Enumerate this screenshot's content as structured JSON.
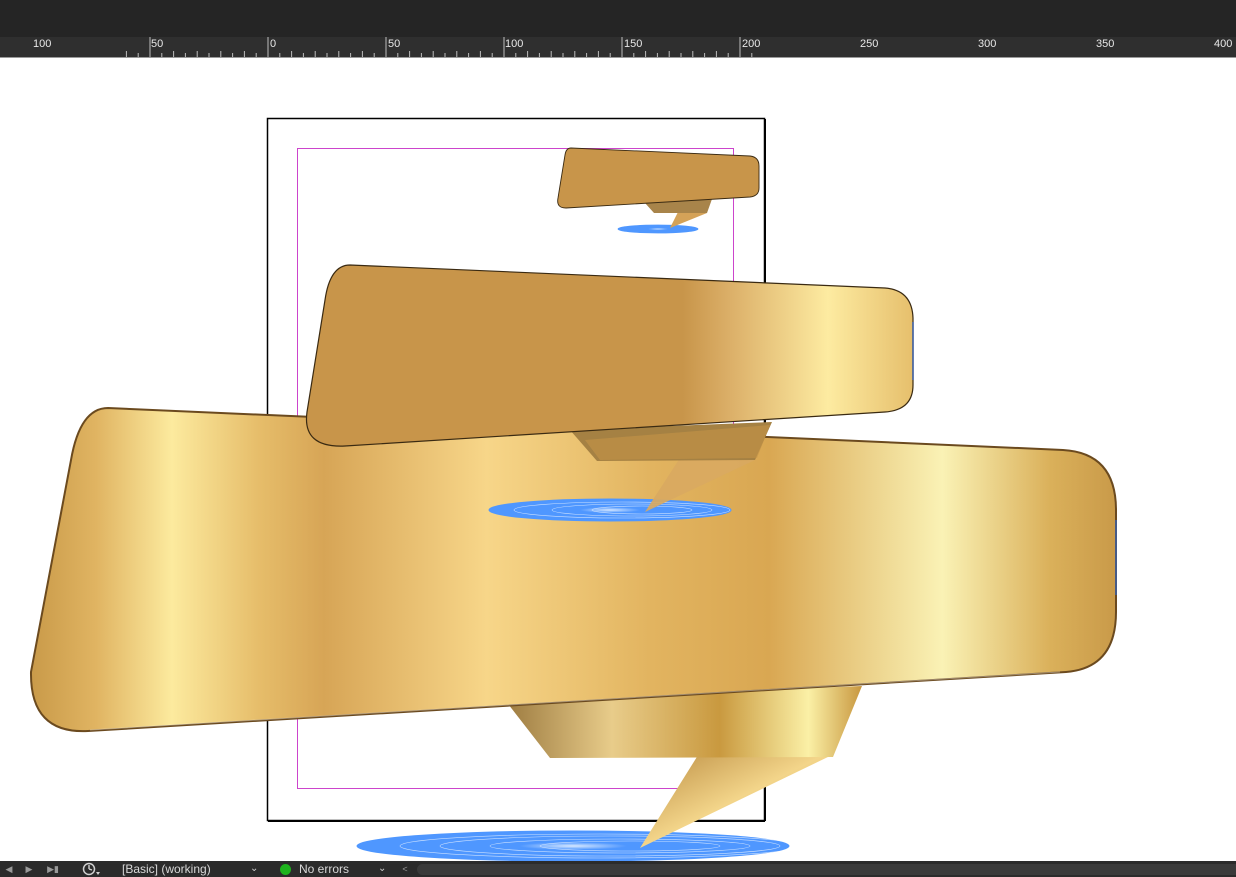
{
  "ruler": {
    "ticks": [
      "100",
      "50",
      "0",
      "50",
      "100",
      "150",
      "200",
      "250",
      "300",
      "350",
      "400"
    ]
  },
  "statusbar": {
    "history_icon": "history-clock-icon",
    "style_label": "[Basic] (working)",
    "preflight_status": "No errors",
    "status_color": "#1db31d"
  },
  "colors": {
    "ui_dark": "#252525",
    "ruler_bg": "#2f2f2f",
    "page_border": "#000000",
    "margin_guide": "#cc44cc",
    "shadow_blue": "#4f97ff",
    "gold_dark": "#c8954a",
    "gold_light": "#fdeba1",
    "gold_edge": "#6b4a1f"
  }
}
